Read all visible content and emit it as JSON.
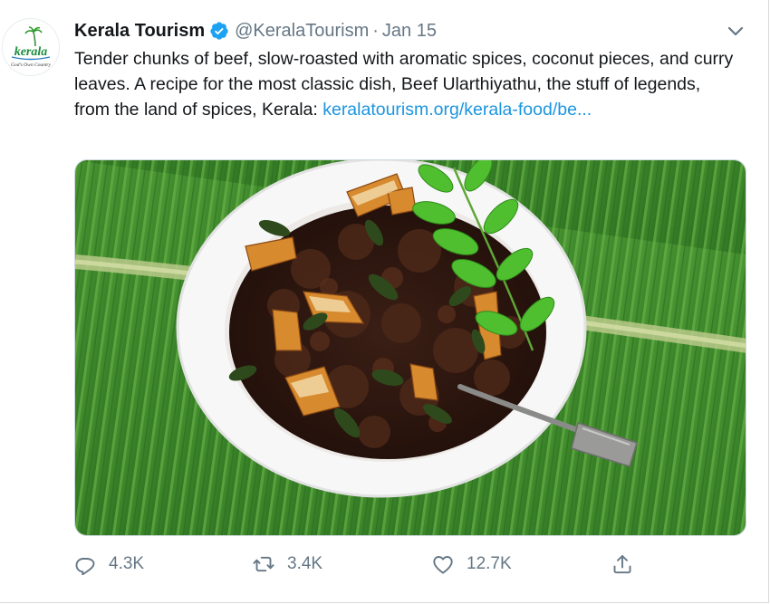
{
  "tweet": {
    "author_name": "Kerala Tourism",
    "handle": "@KeralaTourism",
    "separator": "·",
    "date": "Jan 15",
    "text": "Tender chunks of beef, slow-roasted with aromatic spices, coconut pieces, and curry leaves. A recipe for the most classic dish, Beef Ularthiyathu, the stuff of legends, from the land of spices, Kerala: ",
    "link_text": "keralatourism.org/kerala-food/be...",
    "verified": true
  },
  "avatar": {
    "brand": "kerala",
    "tagline": "God's Own Country"
  },
  "actions": {
    "reply_count": "4.3K",
    "retweet_count": "3.4K",
    "like_count": "12.7K"
  },
  "colors": {
    "link": "#1b95e0",
    "verified": "#1da1f2",
    "muted": "#657786",
    "text": "#14171a"
  },
  "icons": [
    "kerala-logo",
    "verified-badge-icon",
    "chevron-down-icon",
    "reply-icon",
    "retweet-icon",
    "like-icon",
    "share-icon"
  ]
}
